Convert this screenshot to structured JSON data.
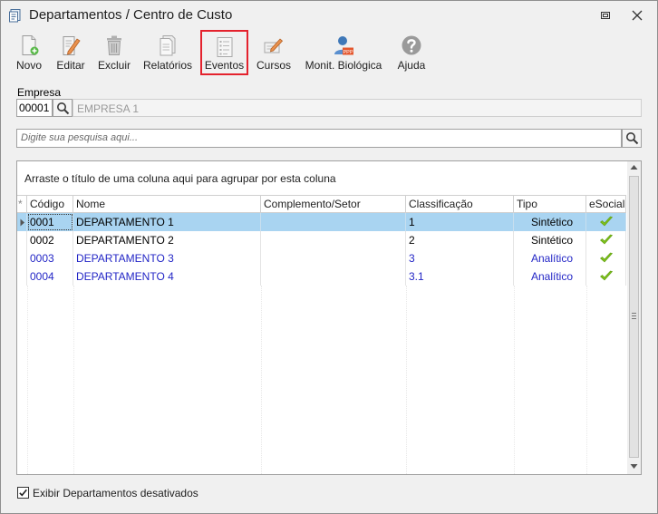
{
  "window": {
    "title": "Departamentos / Centro de Custo"
  },
  "toolbar": {
    "novo": "Novo",
    "editar": "Editar",
    "excluir": "Excluir",
    "relatorios": "Relatórios",
    "eventos": "Eventos",
    "cursos": "Cursos",
    "monit": "Monit. Biológica",
    "ajuda": "Ajuda",
    "ppp_badge": "PPP"
  },
  "empresa": {
    "label": "Empresa",
    "code": "00001",
    "name": "EMPRESA 1"
  },
  "search": {
    "placeholder": "Digite sua pesquisa aqui..."
  },
  "grid": {
    "group_hint": "Arraste o título de uma coluna aqui para agrupar por esta coluna",
    "columns": {
      "codigo": "Código",
      "nome": "Nome",
      "complemento": "Complemento/Setor",
      "classificacao": "Classificação",
      "tipo": "Tipo",
      "esocial": "eSocial"
    },
    "rows": [
      {
        "codigo": "0001",
        "nome": "DEPARTAMENTO 1",
        "complemento": "",
        "classificacao": "1",
        "tipo": "Sintético",
        "esocial": true
      },
      {
        "codigo": "0002",
        "nome": "DEPARTAMENTO 2",
        "complemento": "",
        "classificacao": "2",
        "tipo": "Sintético",
        "esocial": true
      },
      {
        "codigo": "0003",
        "nome": "DEPARTAMENTO 3",
        "complemento": "",
        "classificacao": "3",
        "tipo": "Analítico",
        "esocial": true
      },
      {
        "codigo": "0004",
        "nome": "DEPARTAMENTO 4",
        "complemento": "",
        "classificacao": "3.1",
        "tipo": "Analítico",
        "esocial": true
      }
    ]
  },
  "footer": {
    "show_inactive_label": "Exibir Departamentos desativados",
    "show_inactive_checked": true
  },
  "colors": {
    "selected_row": "#a9d4f1",
    "analytic_text": "#2326c6",
    "highlight_border": "#e4222d",
    "check_green": "#7ec21a"
  }
}
